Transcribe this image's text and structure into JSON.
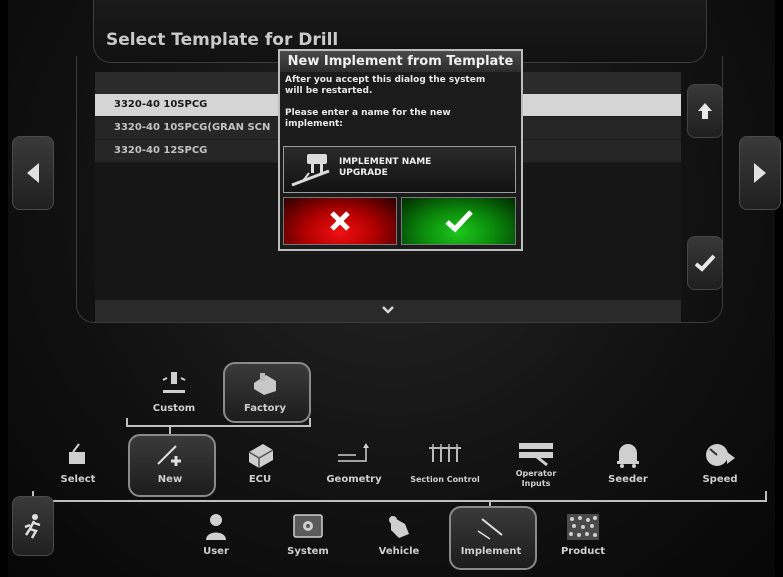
{
  "panel": {
    "title": "Select Template for Drill"
  },
  "templates": [
    {
      "label": "3320-40 10SPCG",
      "selected": true
    },
    {
      "label": "3320-40 10SPCG(GRAN SCN",
      "selected": false
    },
    {
      "label": "3320-40 12SPCG",
      "selected": false
    }
  ],
  "dialog": {
    "title": "New Implement from Template",
    "message_line1": "After you accept this dialog the system",
    "message_line2": "will be restarted.",
    "prompt_line1": "Please enter a name for the new",
    "prompt_line2": "implement:",
    "name_line1": "IMPLEMENT NAME",
    "name_line2": "UPGRADE"
  },
  "submenu": {
    "custom": "Custom",
    "factory": "Factory"
  },
  "implement_menu": {
    "items": [
      "Select",
      "New",
      "ECU",
      "Geometry",
      "Section Control",
      "Operator Inputs",
      "Seeder",
      "Speed"
    ]
  },
  "main_nav": {
    "items": [
      "User",
      "System",
      "Vehicle",
      "Implement",
      "Product"
    ]
  },
  "colors": {
    "cancel": "#d00000",
    "accept": "#10a010",
    "selected_row": "#d5d5d5"
  }
}
